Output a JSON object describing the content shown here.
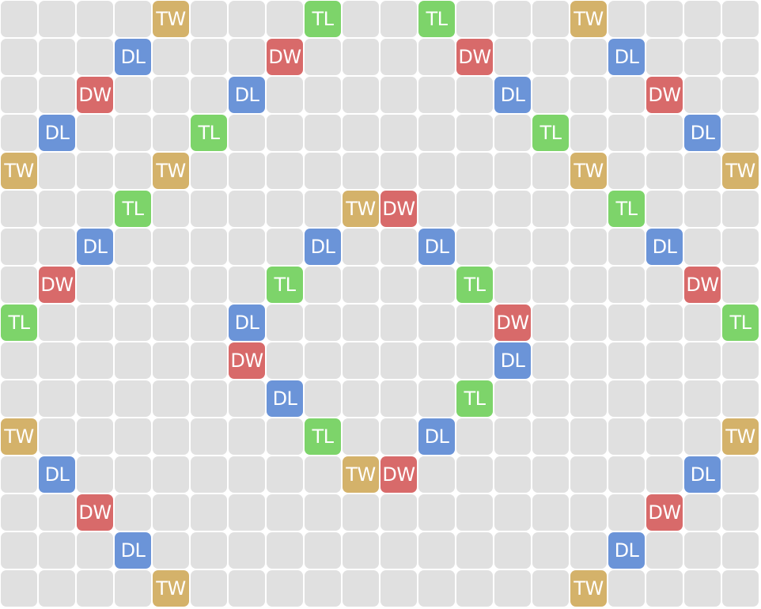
{
  "board": {
    "columns": 20,
    "rows": 16,
    "colors": {
      "empty": "#e0e0e0",
      "DL": "#6b94d8",
      "TL": "#7dd46a",
      "DW": "#d86a6a",
      "TW": "#d4b26a",
      "grid_background": "#ffffff",
      "label_text": "#ffffff"
    },
    "labels": {
      "DL": "DL",
      "TL": "TL",
      "DW": "DW",
      "TW": "TW"
    },
    "grid": [
      [
        "",
        "",
        "",
        "",
        "TW",
        "",
        "",
        "",
        "TL",
        "",
        "",
        "TL",
        "",
        "",
        "",
        "TW",
        "",
        "",
        "",
        ""
      ],
      [
        "",
        "",
        "",
        "DL",
        "",
        "",
        "",
        "DW",
        "",
        "",
        "",
        "",
        "DW",
        "",
        "",
        "",
        "DL",
        "",
        "",
        ""
      ],
      [
        "",
        "",
        "DW",
        "",
        "",
        "",
        "DL",
        "",
        "",
        "",
        "",
        "",
        "",
        "DL",
        "",
        "",
        "",
        "DW",
        "",
        ""
      ],
      [
        "",
        "DL",
        "",
        "",
        "",
        "TL",
        "",
        "",
        "",
        "",
        "",
        "",
        "",
        "",
        "TL",
        "",
        "",
        "",
        "DL",
        ""
      ],
      [
        "TW",
        "",
        "",
        "",
        "TW",
        "",
        "",
        "",
        "",
        "",
        "",
        "",
        "",
        "",
        "",
        "TW",
        "",
        "",
        "",
        "TW"
      ],
      [
        "",
        "",
        "",
        "TL",
        "",
        "",
        "",
        "",
        "",
        "TW",
        "DW",
        "",
        "",
        "",
        "",
        "",
        "TL",
        "",
        "",
        ""
      ],
      [
        "",
        "",
        "DL",
        "",
        "",
        "",
        "",
        "",
        "DL",
        "",
        "",
        "DL",
        "",
        "",
        "",
        "",
        "",
        "DL",
        "",
        ""
      ],
      [
        "",
        "DW",
        "",
        "",
        "",
        "",
        "",
        "TL",
        "",
        "",
        "",
        "",
        "TL",
        "",
        "",
        "",
        "",
        "",
        "DW",
        ""
      ],
      [
        "TL",
        "",
        "",
        "",
        "",
        "",
        "DL",
        "",
        "",
        "",
        "",
        "",
        "",
        "DW",
        "",
        "",
        "",
        "",
        "",
        "TL"
      ],
      [
        "",
        "",
        "",
        "",
        "",
        "",
        "DW",
        "",
        "",
        "",
        "",
        "",
        "",
        "DL",
        "",
        "",
        "",
        "",
        "",
        ""
      ],
      [
        "",
        "",
        "",
        "",
        "",
        "",
        "",
        "DL",
        "",
        "",
        "",
        "",
        "TL",
        "",
        "",
        "",
        "",
        "",
        "",
        ""
      ],
      [
        "TW",
        "",
        "",
        "",
        "",
        "",
        "",
        "",
        "TL",
        "",
        "",
        "DL",
        "",
        "",
        "",
        "",
        "",
        "",
        "",
        "TW"
      ],
      [
        "",
        "DL",
        "",
        "",
        "",
        "",
        "",
        "",
        "",
        "TW",
        "DW",
        "",
        "",
        "",
        "",
        "",
        "",
        "",
        "DL",
        ""
      ],
      [
        "",
        "",
        "DW",
        "",
        "",
        "",
        "",
        "",
        "",
        "",
        "",
        "",
        "",
        "",
        "",
        "",
        "",
        "DW",
        "",
        ""
      ],
      [
        "",
        "",
        "",
        "DL",
        "",
        "",
        "",
        "",
        "",
        "",
        "",
        "",
        "",
        "",
        "",
        "",
        "DL",
        "",
        "",
        ""
      ],
      [
        "",
        "",
        "",
        "",
        "TW",
        "",
        "",
        "",
        "",
        "",
        "",
        "",
        "",
        "",
        "",
        "TW",
        "",
        "",
        "",
        ""
      ]
    ]
  }
}
